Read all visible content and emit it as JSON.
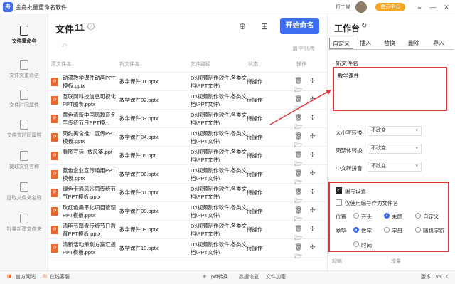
{
  "app": {
    "logo_text": "舟",
    "title": "金舟批量重命名软件",
    "user": "打工猫",
    "vip": "会员中心"
  },
  "window": {
    "menu_icon": "≡",
    "min_icon": "—",
    "close_icon": "✕"
  },
  "sidebar": [
    {
      "label": "文件重命名",
      "icon": "file-rename-icon",
      "active": true
    },
    {
      "label": "文件夹重命名",
      "icon": "folder-rename-icon"
    },
    {
      "label": "文件时间属性",
      "icon": "file-time-icon"
    },
    {
      "label": "文件夹时间属性",
      "icon": "folder-time-icon"
    },
    {
      "label": "提取文件名称",
      "icon": "extract-file-icon"
    },
    {
      "label": "提取文件夹名称",
      "icon": "extract-folder-icon"
    },
    {
      "label": "批量新建文件夹",
      "icon": "new-folder-icon"
    }
  ],
  "header": {
    "title": "文件",
    "count": "11",
    "help": "?",
    "add_file_icon": "⊕",
    "add_folder_icon": "⊞",
    "start_label": "开始命名",
    "undo_icon": "↶",
    "clear_label": "清空列表"
  },
  "table": {
    "columns": [
      "原文件名",
      "新文件名",
      "文件路径",
      "状态",
      "操作"
    ],
    "rows": [
      {
        "orig": "动漫教学课件动画PPT模板.pptx",
        "new": "教学课件01.pptx",
        "path": "D:\\视频制作软件\\各类文档\\PPT文件\\",
        "status": "待操作"
      },
      {
        "orig": "互联网科技信息可视化PPT图表.pptx",
        "new": "教学课件02.pptx",
        "path": "D:\\视频制作软件\\各类文档\\PPT文件\\",
        "status": "待操作"
      },
      {
        "orig": "黄色清新中国风教育冬至传统节日PPT模...",
        "new": "教学课件03.pptx",
        "path": "D:\\视频制作软件\\各类文档\\PPT文件\\",
        "status": "待操作"
      },
      {
        "orig": "简约美食推广宣传PPT模板.pptx",
        "new": "教学课件04.pptx",
        "path": "D:\\视频制作软件\\各类文档\\PPT文件\\",
        "status": "待操作"
      },
      {
        "orig": "看图写话--放风筝.ppt",
        "new": "教学课件05.ppt",
        "path": "D:\\视频制作软件\\各类文档\\PPT文件\\",
        "status": "待操作"
      },
      {
        "orig": "蓝色企业宣传通用PPT模板.pptx",
        "new": "教学课件06.pptx",
        "path": "D:\\视频制作软件\\各类文档\\PPT文件\\",
        "status": "待操作"
      },
      {
        "orig": "绿色卡通风谷雨传统节气PPT模板.pptx",
        "new": "教学课件07.pptx",
        "path": "D:\\视频制作软件\\各类文档\\PPT文件\\",
        "status": "待操作"
      },
      {
        "orig": "玫红色扁平化项目管理PPT模板.pptx",
        "new": "教学课件08.pptx",
        "path": "D:\\视频制作软件\\各类文档\\PPT文件\\",
        "status": "待操作"
      },
      {
        "orig": "清明节踏青传统节日教育PPT模板.pptx",
        "new": "教学课件09.pptx",
        "path": "D:\\视频制作软件\\各类文档\\PPT文件\\",
        "status": "待操作"
      },
      {
        "orig": "清新活动策划方案汇报PPT模板.pptx",
        "new": "教学课件10.pptx",
        "path": "D:\\视频制作软件\\各类文档\\PPT文件\\",
        "status": "待操作"
      }
    ],
    "file_icon_text": "P",
    "actions": "🗑 ✢ 🗁"
  },
  "panel": {
    "title": "工作台",
    "refresh_icon": "↻",
    "tabs": [
      "自定义",
      "插入",
      "替换",
      "删除",
      "导入"
    ],
    "new_name_label": "新文件名",
    "new_name_value": "教学课件",
    "case_label": "大小写转换",
    "case_value": "不改变",
    "trad_label": "简繁体转换",
    "trad_value": "不改变",
    "pinyin_label": "中文转拼音",
    "pinyin_value": "不改变",
    "numbering_label": "编号设置",
    "only_number_label": "仅使用编号作为文件名",
    "position_label": "位置",
    "position_options": [
      "开头",
      "末尾",
      "自定义"
    ],
    "type_label": "类型",
    "type_options": [
      "数字",
      "字母",
      "随机字符"
    ],
    "time_option": "时间",
    "start_label": "起始",
    "step_label": "增量"
  },
  "status": {
    "website": "官方网站",
    "service": "在线客服",
    "pdf": "pdf转换",
    "recover": "数据恢复",
    "compress": "文件加密",
    "version": "版本：v5.1.0"
  }
}
